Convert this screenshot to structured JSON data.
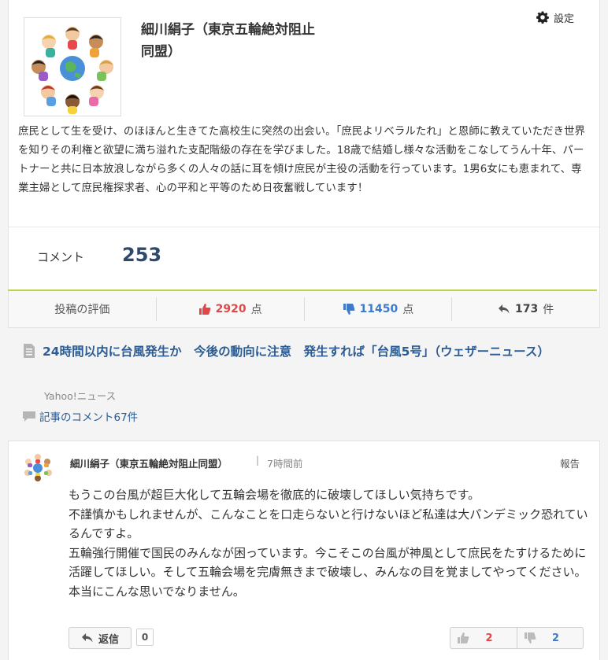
{
  "profile": {
    "name": "細川絹子（東京五輪絶対阻止同盟）",
    "settings_label": "設定",
    "bio": "庶民として生を受け、のほほんと生きてた高校生に突然の出会い。「庶民よリベラルたれ」と恩師に教えていただき世界を知りその利権と欲望に満ち溢れた支配階級の存在を学びました。18歳で結婚し様々な活動をこなしてうん十年、パートナーと共に日本放浪しながら多くの人々の話に耳を傾け庶民が主役の活動を行っています。1男6女にも恵まれて、専業主婦として庶民権探求者、心の平和と平等のため日夜奮戦しています！"
  },
  "summary": {
    "comment_label": "コメント",
    "comment_count": "253"
  },
  "stats": {
    "rating_label": "投稿の評価",
    "likes_value": "2920",
    "likes_unit": "点",
    "dislikes_value": "11450",
    "dislikes_unit": "点",
    "replies_value": "173",
    "replies_unit": "件"
  },
  "article": {
    "title": "24時間以内に台風発生か　今後の動向に注意　発生すれば「台風5号」（ウェザーニュース）",
    "source": "Yahoo!ニュース",
    "comments_link": "記事のコメント67件"
  },
  "comment": {
    "author": "細川絹子（東京五輪絶対阻止同盟）",
    "separator": "|",
    "time": "7時間前",
    "report_label": "報告",
    "lines": [
      "もうこの台風が超巨大化して五輪会場を徹底的に破壊してほしい気持ちです。",
      "不謹慎かもしれませんが、こんなことを口走らないと行けないほど私達は大パンデミック恐れているんですよ。",
      "五輪強行開催で国民のみんなが困っています。今こそこの台風が神風として庶民をたすけるために活躍してほしい。そして五輪会場を完膚無きまで破壊し、みんなの目を覚ましてやってください。",
      "本当にこんな思いでなりません。"
    ],
    "reply_label": "返信",
    "reply_count": "0",
    "like_count": "2",
    "dislike_count": "2"
  },
  "colors": {
    "link_blue": "#2b5c94",
    "like_red": "#e04848",
    "dislike_blue": "#3f7ac8",
    "accent_green": "#b9d44a"
  },
  "icons": [
    "gear-icon",
    "thumbs-up-icon",
    "thumbs-down-icon",
    "reply-arrow-icon",
    "document-icon",
    "speech-bubble-icon"
  ]
}
